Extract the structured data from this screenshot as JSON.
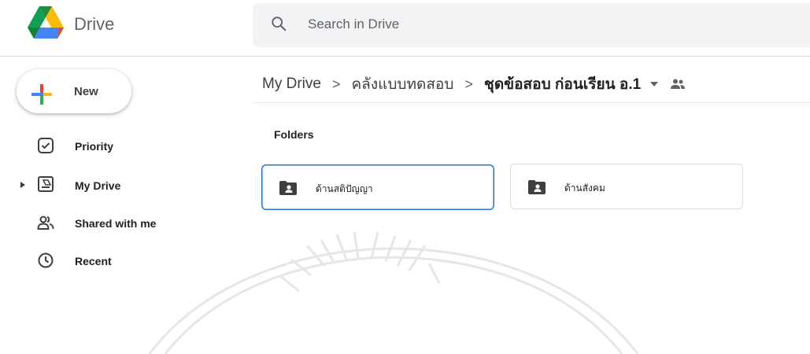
{
  "header": {
    "brand": "Drive",
    "search_placeholder": "Search in Drive"
  },
  "sidebar": {
    "new_label": "New",
    "items": [
      {
        "label": "Priority",
        "icon": "priority-check-icon"
      },
      {
        "label": "My Drive",
        "icon": "my-drive-icon"
      },
      {
        "label": "Shared with me",
        "icon": "shared-with-me-icon"
      },
      {
        "label": "Recent",
        "icon": "clock-icon"
      }
    ]
  },
  "breadcrumb": {
    "items": [
      "My Drive",
      "คลังแบบทดสอบ",
      "ชุดข้อสอบ ก่อนเรียน อ.1"
    ]
  },
  "main": {
    "folders_heading": "Folders",
    "folders": [
      {
        "name": "ด้านสติปัญญา",
        "icon": "shared-folder-icon",
        "selected": true
      },
      {
        "name": "ด้านสังคม",
        "icon": "shared-folder-icon",
        "selected": false
      }
    ]
  },
  "colors": {
    "accent": "#1a73e8",
    "search_bg": "#f1f3f4",
    "border": "#dadce0"
  }
}
